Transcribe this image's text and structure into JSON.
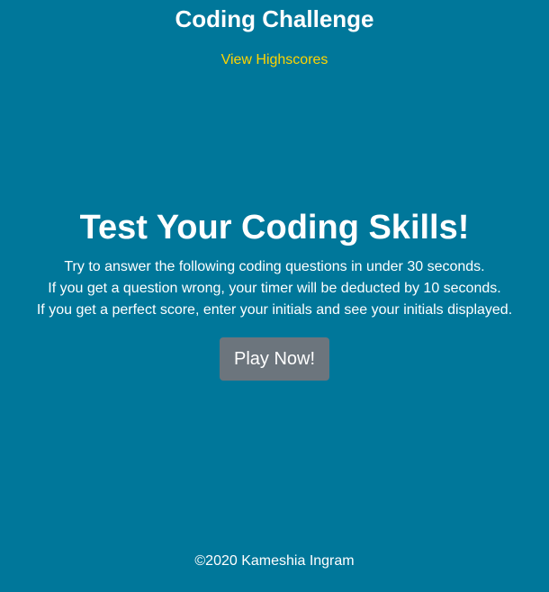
{
  "header": {
    "title": "Coding Challenge",
    "highscores_link": "View Highscores"
  },
  "main": {
    "heading": "Test Your Coding Skills!",
    "instructions": [
      "Try to answer the following coding questions in under 30 seconds.",
      "If you get a question wrong, your timer will be deducted by 10 seconds.",
      "If you get a perfect score, enter your initials and see your initials displayed."
    ],
    "play_button": "Play Now!"
  },
  "footer": {
    "copyright": "©2020 Kameshia Ingram"
  },
  "colors": {
    "background": "#00779a",
    "text": "#ffffff",
    "link": "#ffd500",
    "button": "#6c757d"
  }
}
